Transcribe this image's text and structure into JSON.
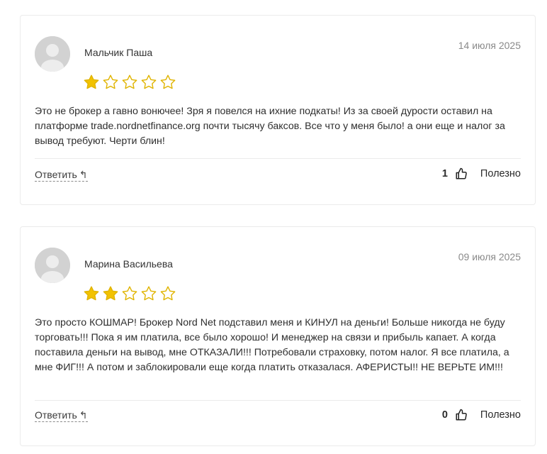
{
  "reviews": [
    {
      "author": "Мальчик Паша",
      "date": "14 июля 2025",
      "rating": 1,
      "max_rating": 5,
      "text": "Это не брокер а гавно вонючее! Зря я повелся на ихние подкаты! Из за своей дурости оставил на платформе trade.nordnetfinance.org почти тысячу баксов. Все что у меня было! а они еще и налог за вывод требуют. Черти блин!",
      "reply_label": "Ответить",
      "likes": "1",
      "helpful_label": "Полезно"
    },
    {
      "author": "Марина Васильева",
      "date": "09 июля 2025",
      "rating": 2,
      "max_rating": 5,
      "text": "Это просто КОШМАР! Брокер Nord Net подставил меня и КИНУЛ на деньги! Больше никогда не буду торговать!!! Пока я им платила, все было хорошо! И менеджер на связи и прибыль капает. А когда поставила деньги на вывод, мне ОТКАЗАЛИ!!! Потребовали страховку, потом налог. Я все платила, а мне ФИГ!!! А потом и заблокировали еще когда платить отказалася. АФЕРИСТЫ!! НЕ ВЕРЬТЕ ИМ!!!",
      "reply_label": "Ответить",
      "likes": "0",
      "helpful_label": "Полезно"
    }
  ],
  "colors": {
    "star_filled": "#f2c200",
    "star_outline": "#e0b400",
    "avatar_bg": "#d2d2d2",
    "divider": "#ebebeb"
  },
  "icons": {
    "avatar": "user-silhouette-icon",
    "reply": "reply-arrow-icon",
    "like": "thumbs-up-icon",
    "star": "star-icon"
  }
}
